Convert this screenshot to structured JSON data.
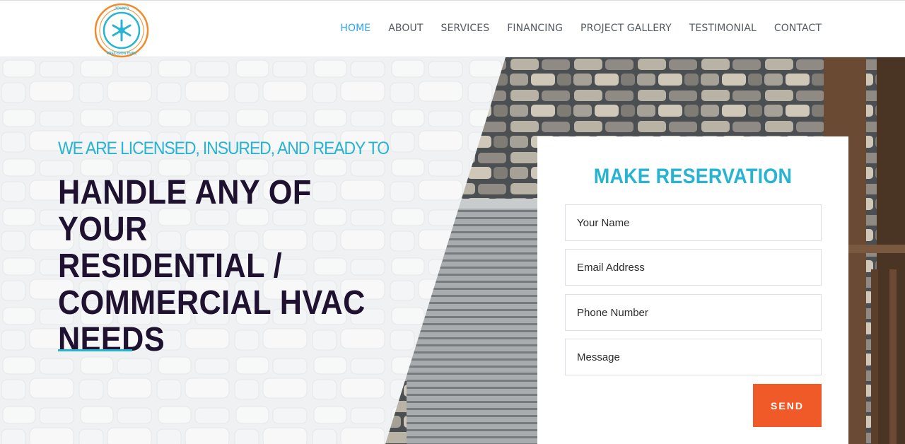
{
  "brand": {
    "logo_top_text": "JOHN'S",
    "logo_bottom_text": "PRECISION HVAC",
    "colors": {
      "accent": "#27b4d3",
      "ring_orange": "#f08a2a",
      "send": "#f05a28",
      "nav_active": "#2ea3f2",
      "headline": "#1e1230"
    }
  },
  "nav": {
    "items": [
      {
        "label": "HOME",
        "active": true
      },
      {
        "label": "ABOUT",
        "active": false
      },
      {
        "label": "SERVICES",
        "active": false
      },
      {
        "label": "FINANCING",
        "active": false
      },
      {
        "label": "PROJECT GALLERY",
        "active": false
      },
      {
        "label": "TESTIMONIAL",
        "active": false
      },
      {
        "label": "CONTACT",
        "active": false
      }
    ]
  },
  "hero": {
    "tagline": "WE ARE LICENSED, INSURED, AND READY TO",
    "headline": "HANDLE ANY OF YOUR\nRESIDENTIAL /\nCOMMERCIAL HVAC\nNEEDS"
  },
  "form": {
    "title": "MAKE RESERVATION",
    "fields": {
      "name_placeholder": "Your Name",
      "email_placeholder": "Email Address",
      "phone_placeholder": "Phone Number",
      "message_placeholder": "Message"
    },
    "send_label": "SEND"
  }
}
